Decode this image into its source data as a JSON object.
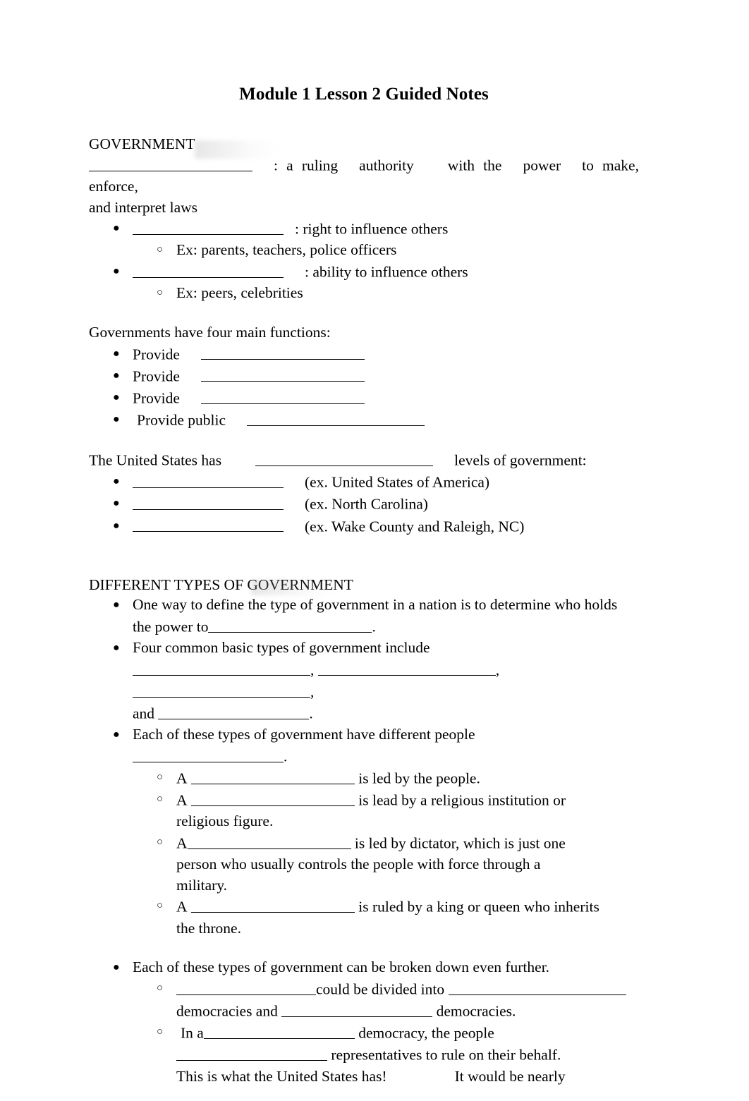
{
  "document": {
    "title": "Module 1 Lesson 2 Guided Notes"
  },
  "sections": [
    {
      "heading": "GOVERNMENT",
      "definition": {
        "after_blank": ": a ruling",
        "word2": "authority",
        "word3": "with the",
        "word4": "power",
        "word5": "to make, enforce,",
        "wrap": "and interpret laws"
      },
      "bullets": [
        {
          "after_blank": ": right to influence others",
          "sub": "Ex: parents, teachers, police officers"
        },
        {
          "after_blank": ": ability to influence others",
          "sub": "Ex: peers, celebrities"
        }
      ]
    },
    {
      "functions_intro": "Governments have four main functions:",
      "functions": [
        {
          "label": "Provide"
        },
        {
          "label": "Provide"
        },
        {
          "label": "Provide"
        },
        {
          "label": "Provide public"
        }
      ]
    },
    {
      "levels_intro_a": "The United States has",
      "levels_intro_b": "levels of government:",
      "levels": [
        {
          "example": "(ex. United States of America)"
        },
        {
          "example": "(ex. North Carolina)"
        },
        {
          "example": "(ex. Wake County and Raleigh, NC)"
        }
      ]
    },
    {
      "heading": "DIFFERENT TYPES OF GOVERNMENT",
      "points": {
        "p1_a": "One way to define the type of government in a nation is to determine",
        "p1_b": "who holds the power to",
        "p1_c": ".",
        "p2_a": "Four common basic types of government include",
        "p2_sep": ",",
        "p2_and": "and",
        "p2_end": ".",
        "p3_a": "Each of these types of government have different people",
        "p3_end": ".",
        "p4": "Each of these types of government can be broken down even further."
      },
      "types": [
        {
          "prefix": "A",
          "text": "is led by the people."
        },
        {
          "prefix": "A",
          "text": "is lead by a religious institution or",
          "wrap": "religious figure."
        },
        {
          "prefix": "A",
          "text": "is led by dictator, which is just one",
          "wrap": "person who usually controls the people with force through a",
          "wrap2": "military."
        },
        {
          "prefix": "A",
          "text": "is ruled by a king or queen who inherits",
          "wrap": "the throne."
        }
      ],
      "further": [
        {
          "mid": "could be divided into",
          "wrap_a": "democracies and",
          "wrap_b": "democracies."
        },
        {
          "prefix": "In a",
          "mid": "democracy, the people",
          "wrap_a": "representatives to rule on their behalf.",
          "wrap_b": "This is what the United States has!",
          "wrap_c": "It would be nearly"
        }
      ]
    }
  ]
}
